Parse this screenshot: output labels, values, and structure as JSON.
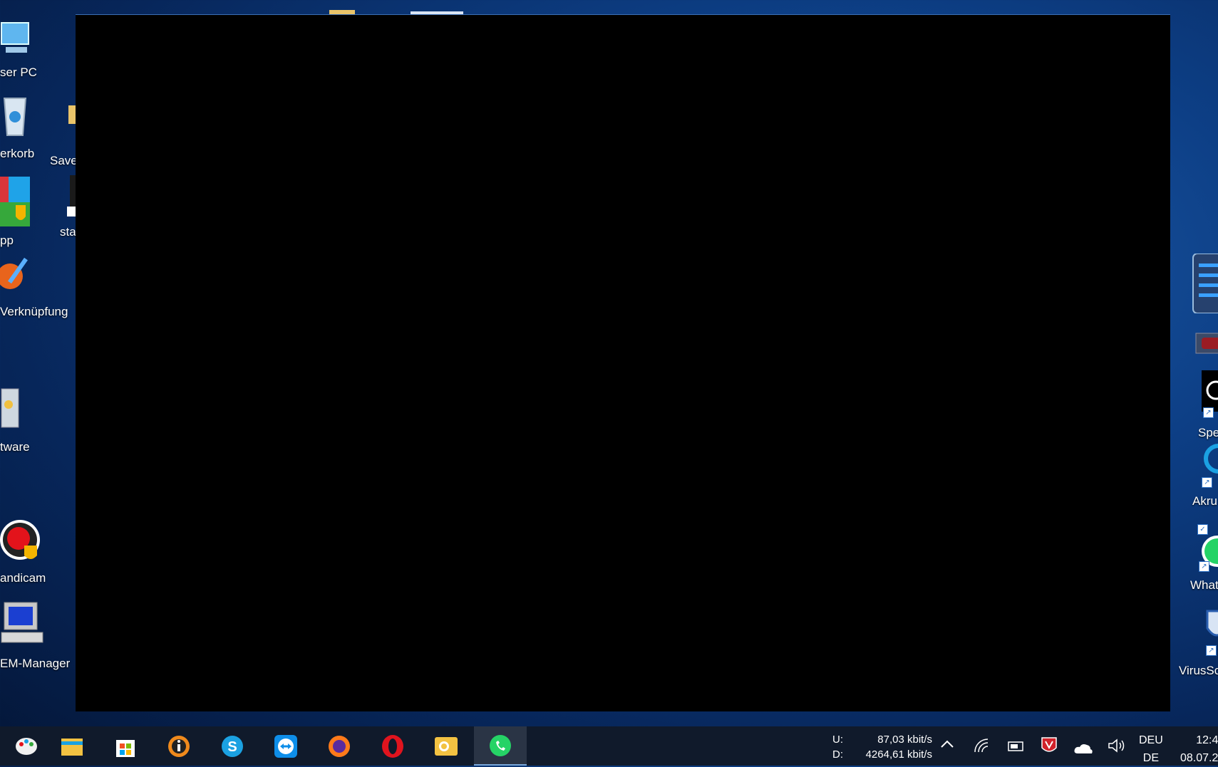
{
  "desktop_left_icons": [
    {
      "label": "ser PC",
      "icon": "computer-icon"
    },
    {
      "label": "erkorb",
      "icon": "recycle-bin-icon"
    },
    {
      "label": "Save",
      "icon": "folder-icon"
    },
    {
      "label": "pp",
      "icon": "app-tiles-icon"
    },
    {
      "label": "sta",
      "icon": "shortcut-icon"
    },
    {
      "label": "Verknüpfung",
      "icon": "pen-tool-icon"
    },
    {
      "label": "tware",
      "icon": "software-box-icon"
    },
    {
      "label": "andicam",
      "icon": "bandicam-icon"
    },
    {
      "label": "EM-Manager",
      "icon": "computer-manager-icon"
    }
  ],
  "desktop_right_icons": [
    {
      "label": "Spe",
      "icon": "speed-icon"
    },
    {
      "label": "Akru",
      "icon": "akru-icon"
    },
    {
      "label": "What",
      "icon": "whatsapp-icon"
    },
    {
      "label": "VirusSc",
      "icon": "virus-scanner-icon"
    }
  ],
  "taskbar": {
    "apps": [
      {
        "name": "paint-app",
        "icon": "palette-icon",
        "color": "#e8e8e8"
      },
      {
        "name": "file-explorer",
        "icon": "folder-icon",
        "color": "#f3c242"
      },
      {
        "name": "microsoft-store",
        "icon": "store-bag-icon",
        "color": "#ffffff"
      },
      {
        "name": "info-app",
        "icon": "info-icon",
        "color": "#f08a1c"
      },
      {
        "name": "skype",
        "icon": "skype-icon",
        "color": "#1ba1e2"
      },
      {
        "name": "teamviewer",
        "icon": "teamviewer-icon",
        "color": "#0e8ee9"
      },
      {
        "name": "firefox",
        "icon": "firefox-icon",
        "color": "#ff7a1a"
      },
      {
        "name": "opera",
        "icon": "opera-icon",
        "color": "#e0141e"
      },
      {
        "name": "outlook",
        "icon": "mail-icon",
        "color": "#f3c242"
      },
      {
        "name": "whatsapp",
        "icon": "whatsapp-icon",
        "color": "#25d366"
      }
    ],
    "network": {
      "up_label": "U:",
      "up_value": "87,03 kbit/s",
      "down_label": "D:",
      "down_value": "4264,61 kbit/s"
    },
    "language": {
      "line1": "DEU",
      "line2": "DE"
    },
    "clock": {
      "time": "12:4",
      "date": "08.07.2"
    }
  }
}
